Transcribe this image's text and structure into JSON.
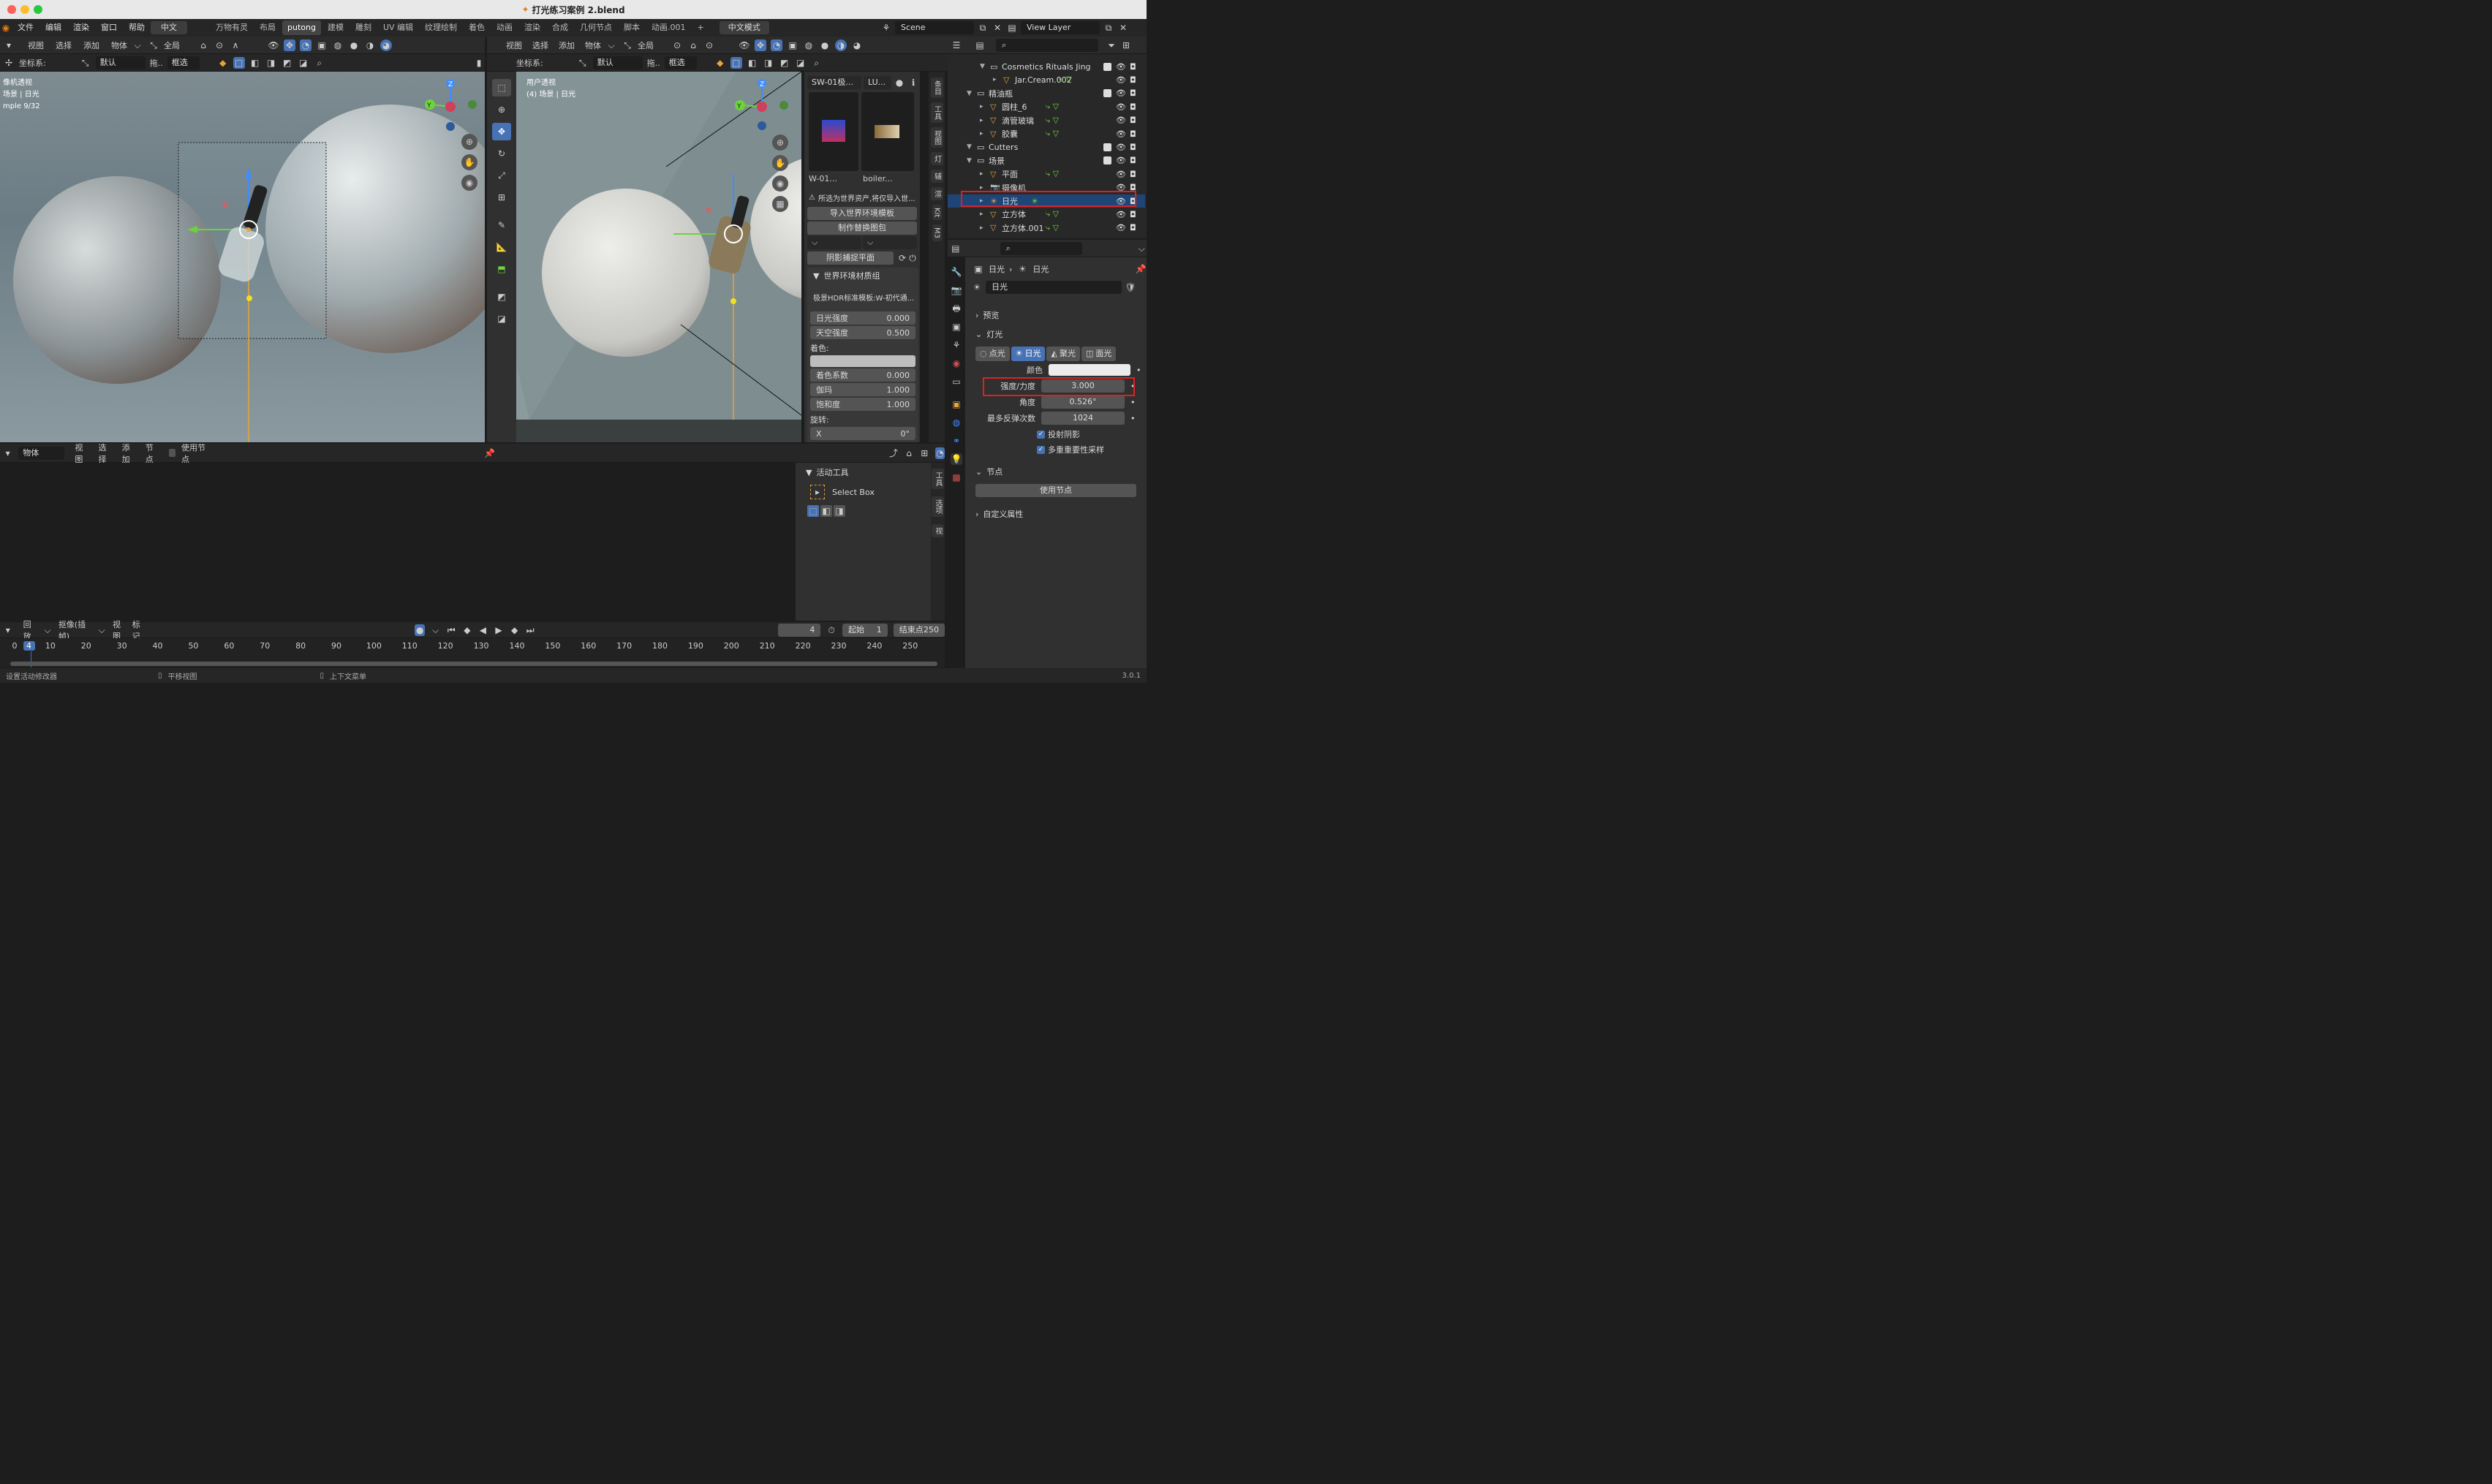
{
  "title": "打光练习案例 2.blend",
  "menu": [
    "文件",
    "编辑",
    "渲染",
    "窗口",
    "帮助",
    "中文"
  ],
  "workspaces": [
    "万物有灵",
    "布局",
    "putong",
    "建模",
    "雕刻",
    "UV 编辑",
    "纹理绘制",
    "着色",
    "动画",
    "渲染",
    "合成",
    "几何节点",
    "脚本",
    "动画.001"
  ],
  "active_workspace": "putong",
  "lang_mode": "中文模式",
  "scene": "Scene",
  "view_layer": "View Layer",
  "vp1": {
    "menu": [
      "视图",
      "选择",
      "添加",
      "物体"
    ],
    "transform": "全局",
    "coord_label": "坐标系:",
    "coord_value": "默认",
    "drag": "拖..",
    "select_mode": "框选",
    "overlay1": "像机透视",
    "overlay2": "场景 | 日光",
    "overlay3": "mple 9/32"
  },
  "vp2": {
    "menu": [
      "视图",
      "选择",
      "添加",
      "物体"
    ],
    "transform": "全局",
    "coord_label": "坐标系:",
    "coord_value": "默认",
    "drag": "拖..",
    "select_mode": "框选",
    "overlay1": "用户透视",
    "overlay2": "(4) 场景 | 日光"
  },
  "npanel": {
    "dd1": "SW-01极...",
    "dd2": "LU...",
    "asset1": "W-01...",
    "asset2": "boiler...",
    "warn": "所选为世界资产,将仅导入世...",
    "btn_import": "导入世界环境模板",
    "btn_make": "制作替换图包",
    "btn_shadow": "阴影捕捉平面",
    "group": "世界环境材质组",
    "preset": "极景HDR标准模板:W-初代通...",
    "props": [
      {
        "l": "日光强度",
        "v": "0.000"
      },
      {
        "l": "天空强度",
        "v": "0.500"
      }
    ],
    "tint": "着色:",
    "props2": [
      {
        "l": "着色系数",
        "v": "0.000"
      },
      {
        "l": "伽玛",
        "v": "1.000"
      },
      {
        "l": "饱和度",
        "v": "1.000"
      }
    ],
    "rot": "旋转:",
    "rx_l": "X",
    "rx_v": "0°"
  },
  "side_tabs_vp2": [
    "条目",
    "工具",
    "视图",
    "灯",
    "辅",
    "渲",
    "Kit",
    "M3"
  ],
  "node_editor": {
    "type": "物体",
    "menu": [
      "视图",
      "选择",
      "添加",
      "节点"
    ],
    "use_nodes": "使用节点",
    "active_tool": "活动工具",
    "tool_name": "Select Box"
  },
  "side_tabs_node": [
    "工具",
    "选项",
    "视"
  ],
  "timeline": {
    "menu": [
      "回放",
      "抠像(插帧)",
      "视图",
      "标记"
    ],
    "frame": "4",
    "start_l": "起始",
    "start_v": "1",
    "end_l": "结束点",
    "end_v": "250",
    "ticks": [
      "0",
      "4",
      "10",
      "20",
      "30",
      "40",
      "50",
      "60",
      "70",
      "80",
      "90",
      "100",
      "110",
      "120",
      "130",
      "140",
      "150",
      "160",
      "170",
      "180",
      "190",
      "200",
      "210",
      "220",
      "230",
      "240",
      "250"
    ]
  },
  "status": {
    "left": "设置活动修改器",
    "mid": "平移视图",
    "right_hint": "上下文菜单",
    "version": "3.0.1"
  },
  "outliner": [
    {
      "name": "Cosmetics Rituals Jing",
      "indent": 2,
      "type": "coll",
      "check": true
    },
    {
      "name": "Jar.Cream.002",
      "indent": 3,
      "type": "obj"
    },
    {
      "name": "精油瓶",
      "indent": 1,
      "type": "coll",
      "check": true
    },
    {
      "name": "圆柱_6",
      "indent": 2,
      "type": "obj"
    },
    {
      "name": "滴管玻璃",
      "indent": 2,
      "type": "obj"
    },
    {
      "name": "胶囊",
      "indent": 2,
      "type": "obj"
    },
    {
      "name": "Cutters",
      "indent": 1,
      "type": "coll",
      "check": true
    },
    {
      "name": "场景",
      "indent": 1,
      "type": "coll",
      "check": true
    },
    {
      "name": "平面",
      "indent": 2,
      "type": "obj"
    },
    {
      "name": "摄像机",
      "indent": 2,
      "type": "cam"
    },
    {
      "name": "日光",
      "indent": 2,
      "type": "light",
      "selected": true
    },
    {
      "name": "立方体",
      "indent": 2,
      "type": "obj"
    },
    {
      "name": "立方体.001",
      "indent": 2,
      "type": "obj"
    }
  ],
  "props": {
    "crumb1": "日光",
    "crumb2": "日光",
    "datablock": "日光",
    "preview": "预览",
    "light_sec": "灯光",
    "light_types": [
      "点光",
      "日光",
      "聚光",
      "面光"
    ],
    "active_type": "日光",
    "color_l": "颜色",
    "fields": [
      {
        "l": "强度/力度",
        "v": "3.000"
      },
      {
        "l": "角度",
        "v": "0.526°"
      },
      {
        "l": "最多反弹次数",
        "v": "1024"
      }
    ],
    "cast_shadow": "投射阴影",
    "mis": "多重重要性采样",
    "nodes_sec": "节点",
    "use_nodes": "使用节点",
    "custom": "自定义属性"
  },
  "colors": {
    "accent": "#4772b3",
    "highlight": "#e02020",
    "selected_row": "#1f4576",
    "light_icon": "#e8a33a"
  }
}
